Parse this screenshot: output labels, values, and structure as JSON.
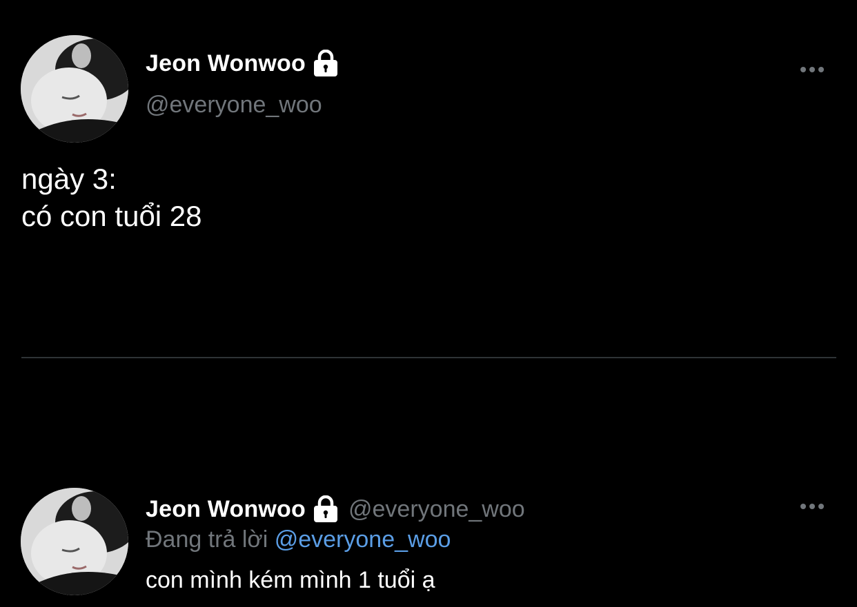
{
  "main_tweet": {
    "display_name": "Jeon Wonwoo",
    "handle": "@everyone_woo",
    "text_line1": "ngày 3:",
    "text_line2": "có con tuổi 28",
    "icons": {
      "lock": "lock-icon",
      "more": "more-options-icon",
      "avatar": "avatar-image"
    }
  },
  "reply_tweet": {
    "display_name": "Jeon Wonwoo",
    "handle": "@everyone_woo",
    "replying_prefix": "Đang trả lời",
    "replying_mention": "@everyone_woo",
    "text": "con mình kém mình 1 tuổi ạ",
    "icons": {
      "lock": "lock-icon",
      "more": "more-options-icon",
      "avatar": "avatar-image"
    }
  },
  "colors": {
    "background": "#000000",
    "primary_text": "#ffffff",
    "secondary_text": "#71767b",
    "mention": "#5b9ee6",
    "divider": "#2f3336"
  }
}
